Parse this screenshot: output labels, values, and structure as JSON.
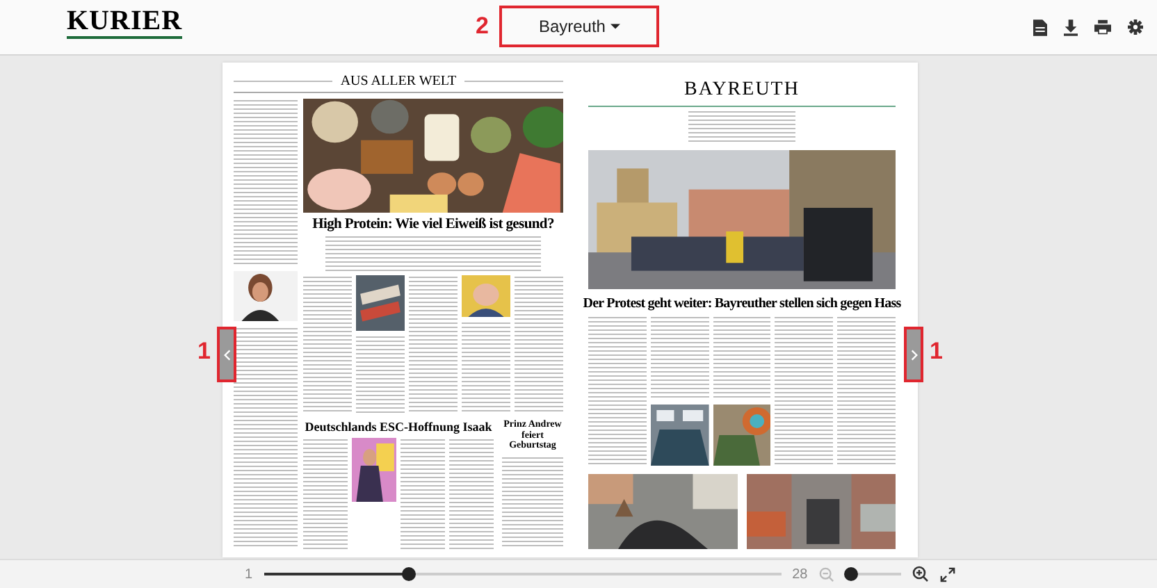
{
  "header": {
    "logo": "KURIER",
    "edition": "Bayreuth"
  },
  "annotations": [
    {
      "kind": "edition",
      "label": "2"
    },
    {
      "kind": "prev",
      "label": "1"
    },
    {
      "kind": "next",
      "label": "1"
    }
  ],
  "left_page": {
    "section": "AUS ALLER WELT",
    "headline": "High Protein: Wie viel Eiweiß ist gesund?",
    "second_headline": "Deutschlands ESC-Hoffnung Isaak",
    "side_headline": "Prinz Andrew feiert Geburtstag"
  },
  "right_page": {
    "section": "BAYREUTH",
    "headline": "Der Protest geht weiter: Bayreuther stellen sich gegen Hass"
  },
  "pager": {
    "first": "1",
    "last": "28",
    "level": 0.28
  },
  "zoom": {
    "level": 0.1
  }
}
